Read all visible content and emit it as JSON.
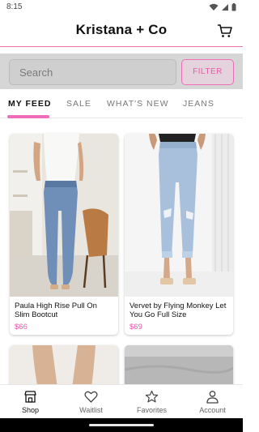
{
  "status_bar": {
    "time": "8:15"
  },
  "header": {
    "title": "Kristana + Co",
    "cart_icon": "cart-icon"
  },
  "search": {
    "placeholder": "Search",
    "value": "",
    "filter_label": "FILTER"
  },
  "tabs": [
    {
      "label": "MY FEED",
      "active": true
    },
    {
      "label": "SALE",
      "active": false
    },
    {
      "label": "WHAT'S NEW",
      "active": false
    },
    {
      "label": "JEANS",
      "active": false
    }
  ],
  "products": [
    {
      "name": "Paula High Rise Pull On Slim Bootcut",
      "price": "$66"
    },
    {
      "name": "Vervet by Flying Monkey Let You Go Full Size",
      "price": "$69"
    }
  ],
  "bottom_nav": [
    {
      "label": "Shop",
      "icon": "shop-icon",
      "active": true
    },
    {
      "label": "Waitlist",
      "icon": "heart-icon",
      "active": false
    },
    {
      "label": "Favorites",
      "icon": "star-icon",
      "active": false
    },
    {
      "label": "Account",
      "icon": "person-icon",
      "active": false
    }
  ],
  "colors": {
    "accent": "#f06eb8",
    "price": "#e55aa8",
    "search_band": "#d6d6d6"
  }
}
